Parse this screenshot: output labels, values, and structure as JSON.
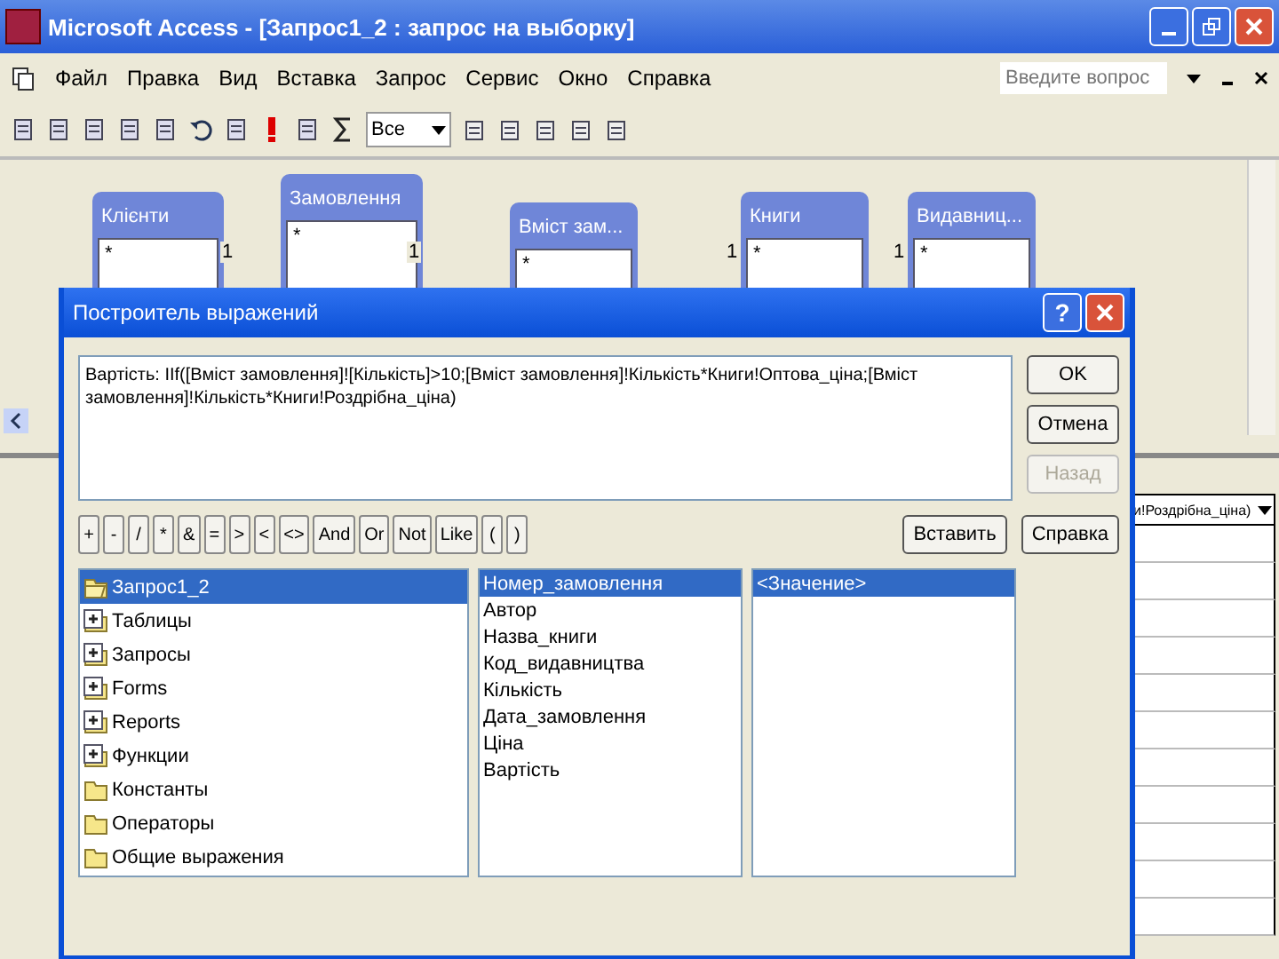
{
  "window": {
    "title": "Microsoft Access - [Запрос1_2 : запрос на выборку]"
  },
  "menu": [
    "Файл",
    "Правка",
    "Вид",
    "Вставка",
    "Запрос",
    "Сервис",
    "Окно",
    "Справка"
  ],
  "help_search": {
    "placeholder": "Введите вопрос"
  },
  "toolbar": {
    "top_values": "Все"
  },
  "tables": [
    {
      "title": "Клієнти",
      "fields": [
        "*"
      ]
    },
    {
      "title": "Замовлення",
      "fields": [
        "*"
      ]
    },
    {
      "title": "Вміст зам...",
      "fields": [
        "*"
      ]
    },
    {
      "title": "Книги",
      "fields": [
        "*"
      ]
    },
    {
      "title": "Видавниц...",
      "fields": [
        "*"
      ]
    }
  ],
  "join_labels": [
    "1",
    "1",
    "1",
    "1"
  ],
  "grid": {
    "field_cell": "и!Роздрібна_ціна)"
  },
  "dialog": {
    "title": "Построитель выражений",
    "help_glyph": "?",
    "expression": "Вартість: IIf([Вміст замовлення]![Кількість]>10;[Вміст замовлення]!Кількість*Книги!Оптова_ціна;[Вміст замовлення]!Кількість*Книги!Роздрібна_ціна)",
    "side_buttons": [
      {
        "label": "OK",
        "disabled": false
      },
      {
        "label": "Отмена",
        "disabled": false
      },
      {
        "label": "Назад",
        "disabled": true
      }
    ],
    "operators": [
      "+",
      "-",
      "/",
      "*",
      "&",
      "=",
      ">",
      "<",
      "<>",
      "And",
      "Or",
      "Not",
      "Like",
      "(",
      ")"
    ],
    "insert_button": "Вставить",
    "help_button": "Справка",
    "objects": [
      {
        "label": "Запрос1_2",
        "kind": "open",
        "selected": true
      },
      {
        "label": "Таблицы",
        "kind": "plus",
        "selected": false
      },
      {
        "label": "Запросы",
        "kind": "plus",
        "selected": false
      },
      {
        "label": "Forms",
        "kind": "plus",
        "selected": false
      },
      {
        "label": "Reports",
        "kind": "plus",
        "selected": false
      },
      {
        "label": "Функции",
        "kind": "plus",
        "selected": false
      },
      {
        "label": "Константы",
        "kind": "folder",
        "selected": false
      },
      {
        "label": "Операторы",
        "kind": "folder",
        "selected": false
      },
      {
        "label": "Общие выражения",
        "kind": "folder",
        "selected": false
      }
    ],
    "fields": [
      {
        "label": "Номер_замовлення",
        "selected": true
      },
      {
        "label": "Автор",
        "selected": false
      },
      {
        "label": "Назва_книги",
        "selected": false
      },
      {
        "label": "Код_видавництва",
        "selected": false
      },
      {
        "label": "Кількість",
        "selected": false
      },
      {
        "label": "Дата_замовлення",
        "selected": false
      },
      {
        "label": "Ціна",
        "selected": false
      },
      {
        "label": "Вартість",
        "selected": false
      }
    ],
    "values": [
      {
        "label": "<Значение>",
        "selected": true
      }
    ]
  }
}
